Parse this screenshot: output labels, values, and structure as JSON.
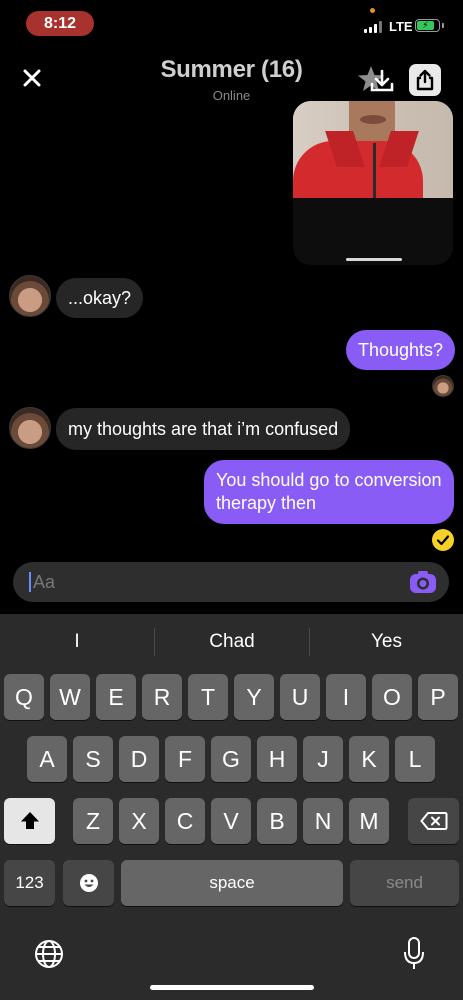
{
  "status_bar": {
    "time": "8:12",
    "network": "LTE",
    "battery_level": 0.8,
    "icons": [
      "signal-icon",
      "battery-charging-icon"
    ]
  },
  "header": {
    "title": "Summer (16)",
    "subtitle": "Online",
    "icons": [
      "close-icon",
      "star-icon",
      "download-icon",
      "share-icon"
    ]
  },
  "messages": [
    {
      "direction": "incoming",
      "text": "...okay?"
    },
    {
      "direction": "outgoing",
      "text": "Thoughts?"
    },
    {
      "direction": "incoming",
      "text": "my thoughts are that i’m confused"
    },
    {
      "direction": "outgoing",
      "text": "You should go to conversion therapy then"
    }
  ],
  "composer": {
    "placeholder": "Aa",
    "icons": [
      "camera-icon"
    ]
  },
  "keyboard": {
    "suggestions": [
      "I",
      "Chad",
      "Yes"
    ],
    "row1": [
      "Q",
      "W",
      "E",
      "R",
      "T",
      "Y",
      "U",
      "I",
      "O",
      "P"
    ],
    "row2": [
      "A",
      "S",
      "D",
      "F",
      "G",
      "H",
      "J",
      "K",
      "L"
    ],
    "row3": [
      "Z",
      "X",
      "C",
      "V",
      "B",
      "N",
      "M"
    ],
    "numbers_label": "123",
    "space_label": "space",
    "send_label": "send",
    "icons": [
      "shift-icon",
      "backspace-icon",
      "emoji-icon",
      "globe-icon",
      "microphone-icon"
    ]
  },
  "colors": {
    "outgoing_bubble": "#8a5cf6",
    "incoming_bubble": "#262626",
    "read_check": "#f5d12a",
    "time_pill": "#a8322d"
  }
}
